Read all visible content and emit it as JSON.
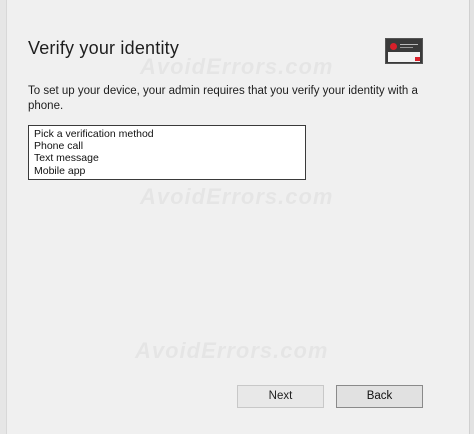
{
  "dialog": {
    "title": "Verify your identity",
    "description": "To set up your device, your admin requires that you verify your identity with a phone."
  },
  "verification_list": {
    "options": [
      "Pick a verification method",
      "Phone call",
      "Text message",
      "Mobile app"
    ]
  },
  "buttons": {
    "next_label": "Next",
    "back_label": "Back"
  },
  "watermark": {
    "text": "AvoidErrors.com"
  }
}
